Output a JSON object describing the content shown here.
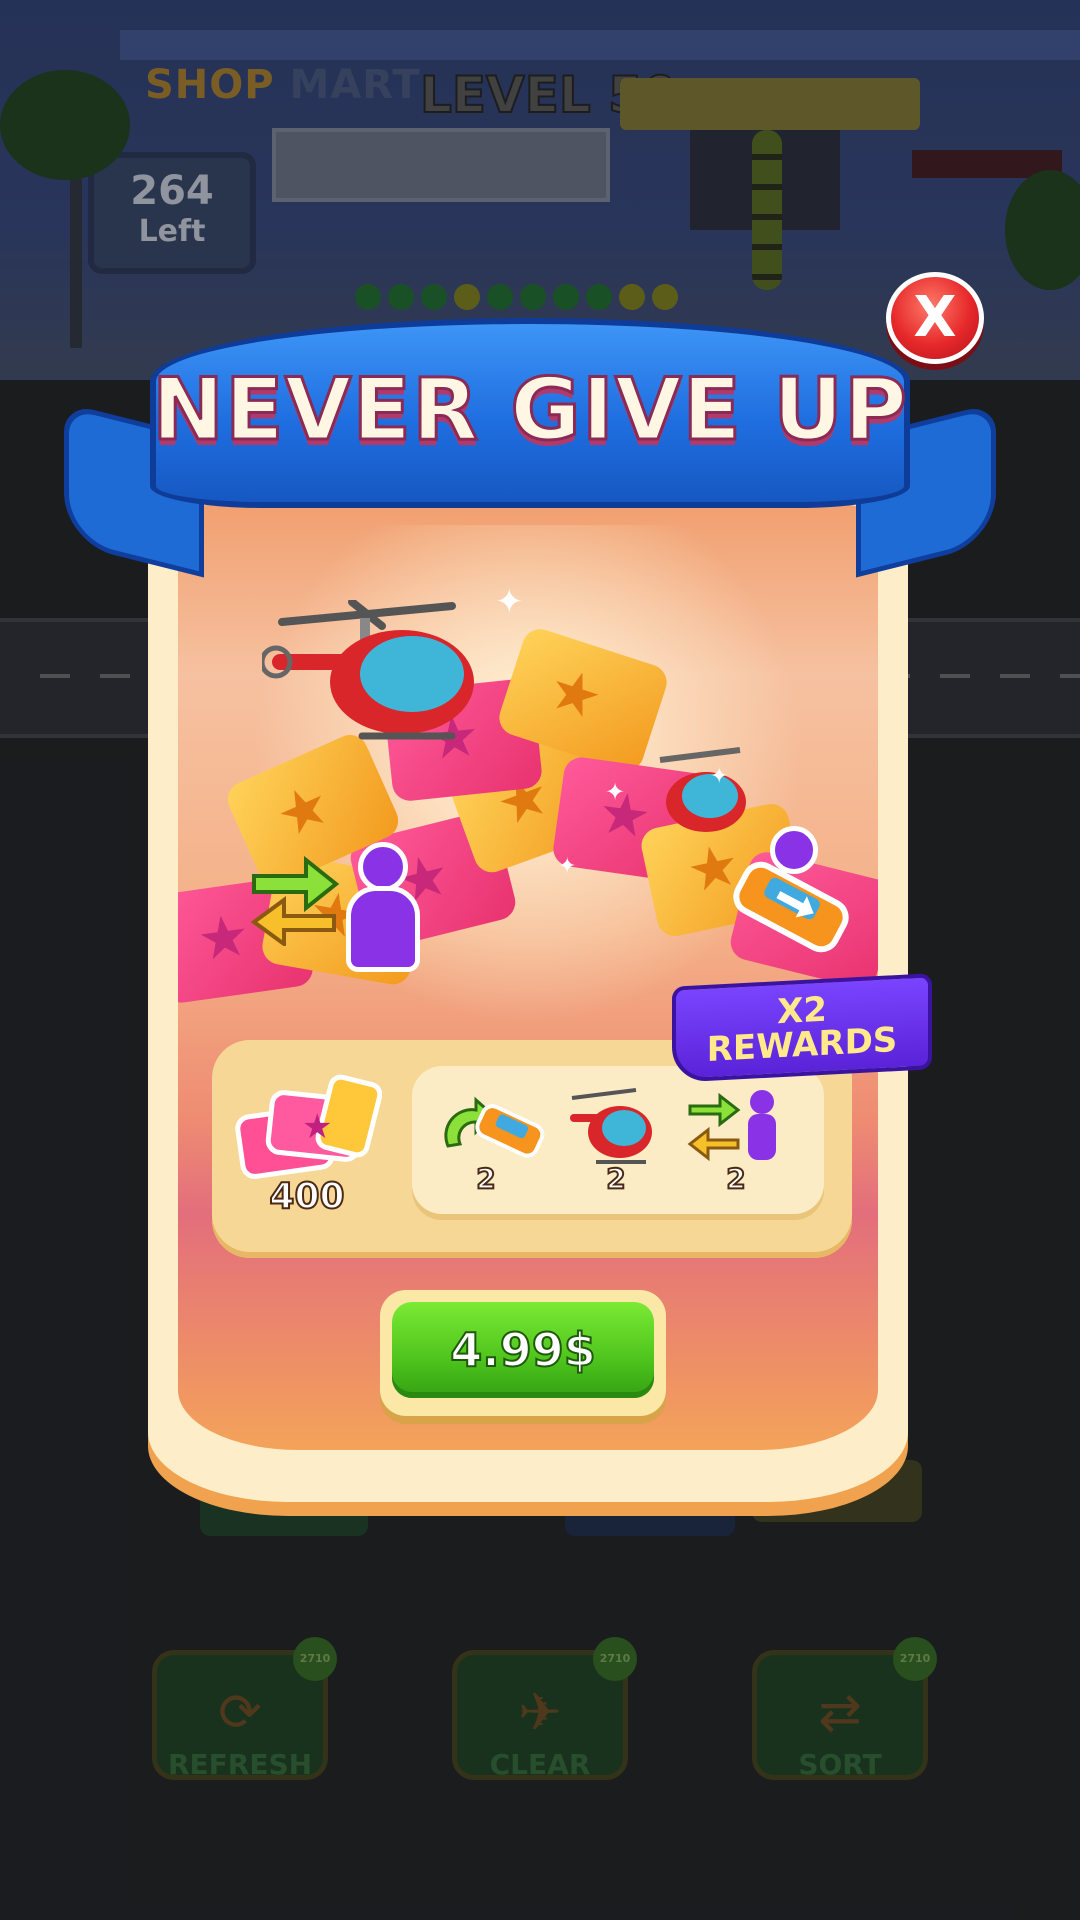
{
  "background": {
    "store_name_part1": "SHOP",
    "store_name_part2": "MART",
    "level_label": "LEVEL 50",
    "remaining_count": "264",
    "remaining_label": "Left",
    "bottom_buttons": [
      {
        "label": "REFRESH",
        "cost": "2710",
        "icon": "refresh-car-icon"
      },
      {
        "label": "CLEAR",
        "cost": "2710",
        "icon": "helicopter-icon"
      },
      {
        "label": "SORT",
        "cost": "2710",
        "icon": "swap-figure-icon"
      }
    ]
  },
  "modal": {
    "title": "NEVER GIVE UP",
    "close_label": "X",
    "badge_line1": "X2",
    "badge_line2": "REWARDS",
    "main_reward": {
      "icon": "ticket-icon",
      "amount": "400"
    },
    "boosters": [
      {
        "icon": "refresh-car-icon",
        "count": "2"
      },
      {
        "icon": "helicopter-icon",
        "count": "2"
      },
      {
        "icon": "swap-figure-icon",
        "count": "2"
      }
    ],
    "price_label": "4.99$"
  },
  "colors": {
    "banner_blue": "#1f6ee0",
    "card_cream": "#fdeec9",
    "price_green": "#4ec41c",
    "badge_purple": "#6a33f0",
    "close_red": "#e6282a"
  }
}
